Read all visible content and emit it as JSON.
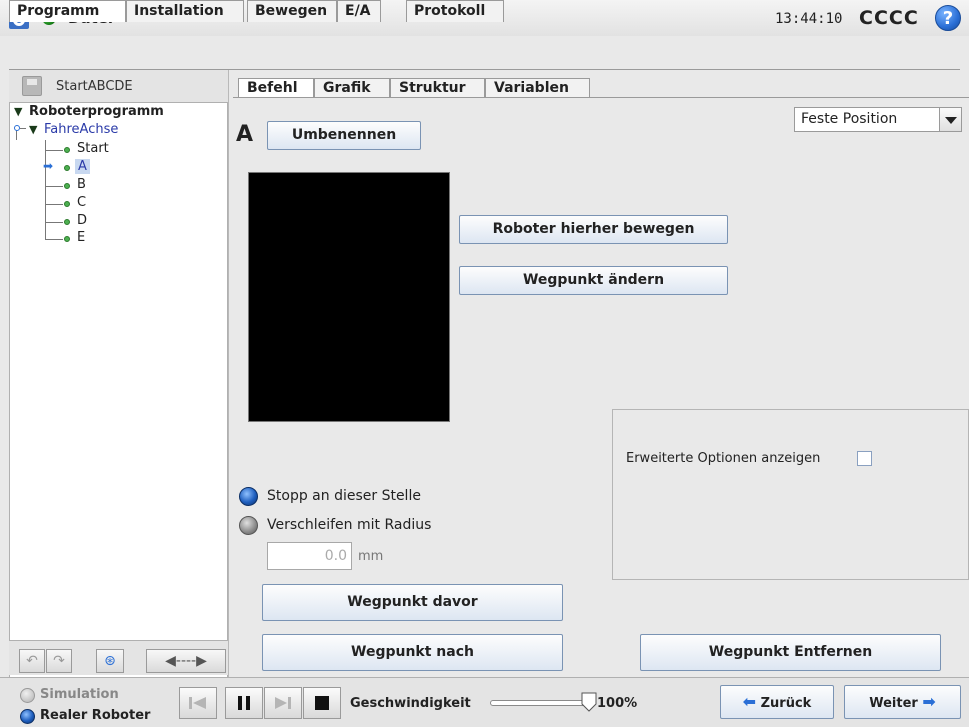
{
  "header": {
    "file_label": "Datei",
    "clock": "13:44:10",
    "robot_name": "CCCC",
    "help_glyph": "?"
  },
  "main_tabs": [
    {
      "label": "Programm",
      "active": true
    },
    {
      "label": "Installation",
      "active": false
    },
    {
      "label": "Bewegen",
      "active": false
    },
    {
      "label": "E/A",
      "active": false
    },
    {
      "label": "Protokoll",
      "active": false
    }
  ],
  "left_panel": {
    "program_name": "StartABCDE",
    "tree": {
      "root": "Roboterprogramm",
      "move_node": "FahreAchse",
      "waypoints": [
        "Start",
        "A",
        "B",
        "C",
        "D",
        "E"
      ],
      "selected": "A"
    }
  },
  "sub_tabs": [
    {
      "label": "Befehl",
      "active": true
    },
    {
      "label": "Grafik",
      "active": false
    },
    {
      "label": "Struktur",
      "active": false
    },
    {
      "label": "Variablen",
      "active": false
    }
  ],
  "command": {
    "waypoint_name": "A",
    "rename_button": "Umbenennen",
    "position_type": "Feste Position",
    "move_here_button": "Roboter hierher bewegen",
    "change_waypoint_button": "Wegpunkt ändern",
    "advanced_options_label": "Erweiterte Optionen anzeigen",
    "stop_here_label": "Stopp an dieser Stelle",
    "blend_label": "Verschleifen mit Radius",
    "blend_radius_value": "0.0",
    "blend_unit": "mm",
    "waypoint_before_button": "Wegpunkt davor",
    "waypoint_after_button": "Wegpunkt nach",
    "remove_waypoint_button": "Wegpunkt Entfernen"
  },
  "bottom": {
    "simulation_label": "Simulation",
    "real_robot_label": "Realer Roboter",
    "speed_label": "Geschwindigkeit",
    "speed_value": "100%",
    "speed_fraction": 1.0,
    "back_button": "Zurück",
    "next_button": "Weiter"
  }
}
